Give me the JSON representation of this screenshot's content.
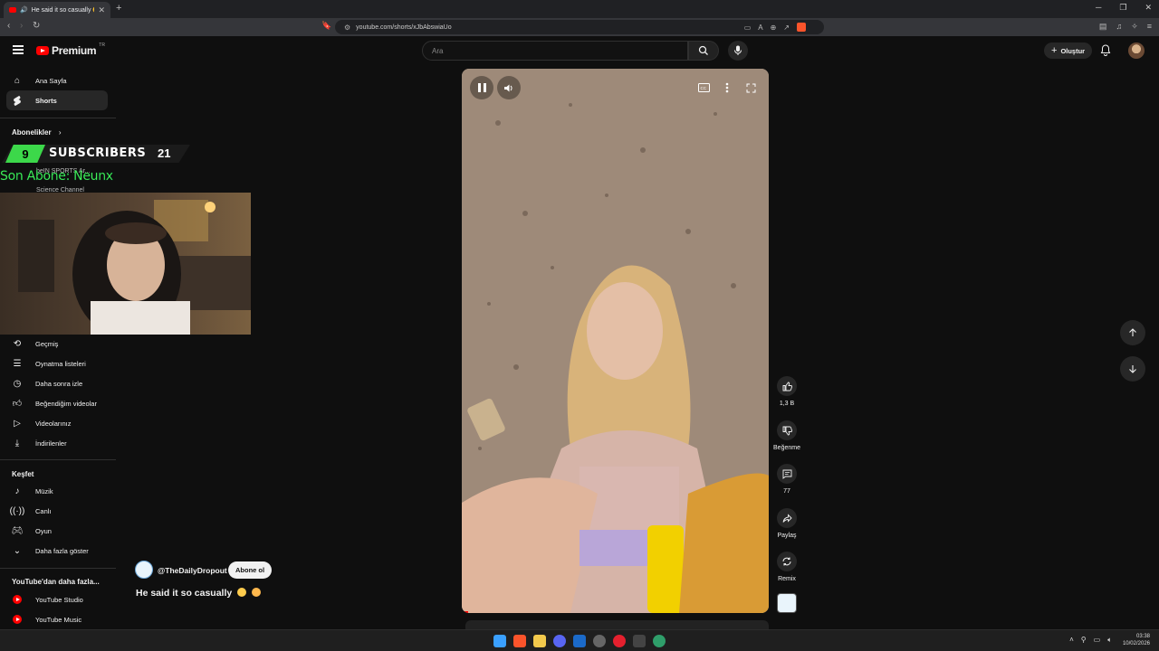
{
  "browser": {
    "tab_title": "He said it so casually 😅😏",
    "url": "youtube.com/shorts/xJbAbswiaUo"
  },
  "header": {
    "logo_text": "Premium",
    "logo_suffix": "TR",
    "search_placeholder": "Ara",
    "create_label": "Oluştur"
  },
  "sidebar": {
    "top_items": [
      {
        "label": "Ana Sayfa",
        "icon": "home-icon"
      },
      {
        "label": "Shorts",
        "icon": "shorts-icon"
      }
    ],
    "subscriptions_heading": "Abonelikler",
    "subscriptions": [
      {
        "label": "beIN SPORTS Ar..."
      },
      {
        "label": "Science Channel"
      }
    ],
    "you_items": [
      {
        "label": "Geçmiş",
        "icon": "history-icon"
      },
      {
        "label": "Oynatma listeleri",
        "icon": "playlist-icon"
      },
      {
        "label": "Daha sonra izle",
        "icon": "watch-later-icon"
      },
      {
        "label": "Beğendiğim videolar",
        "icon": "liked-icon"
      },
      {
        "label": "Videolarınız",
        "icon": "your-videos-icon"
      },
      {
        "label": "İndirilenler",
        "icon": "download-icon"
      }
    ],
    "explore_heading": "Keşfet",
    "explore_items": [
      {
        "label": "Müzik",
        "icon": "music-icon"
      },
      {
        "label": "Canlı",
        "icon": "live-icon"
      },
      {
        "label": "Oyun",
        "icon": "gaming-icon"
      },
      {
        "label": "Daha fazla göster",
        "icon": "chevron-down-icon"
      }
    ],
    "more_heading": "YouTube'dan daha fazla...",
    "more_items": [
      {
        "label": "YouTube Studio"
      },
      {
        "label": "YouTube Music"
      }
    ]
  },
  "stream_overlay": {
    "sub_left": "9",
    "sub_title": "SUBSCRIBERS",
    "sub_right": "21",
    "last_sub": "Son Abone: Neunx"
  },
  "short": {
    "channel": "@TheDailyDropout",
    "subscribe_label": "Abone ol",
    "title": "He said it so casually",
    "progress": 0.02
  },
  "actions": {
    "like_count": "1,3 B",
    "dislike_label": "Beğenme",
    "comment_count": "77",
    "share_label": "Paylaş",
    "remix_label": "Remix"
  },
  "taskbar": {
    "time": "03:38",
    "date": "10/02/2026"
  },
  "colors": {
    "accent": "#ff0000",
    "overlay_green": "#3cd84a",
    "background": "#0f0f0f"
  }
}
